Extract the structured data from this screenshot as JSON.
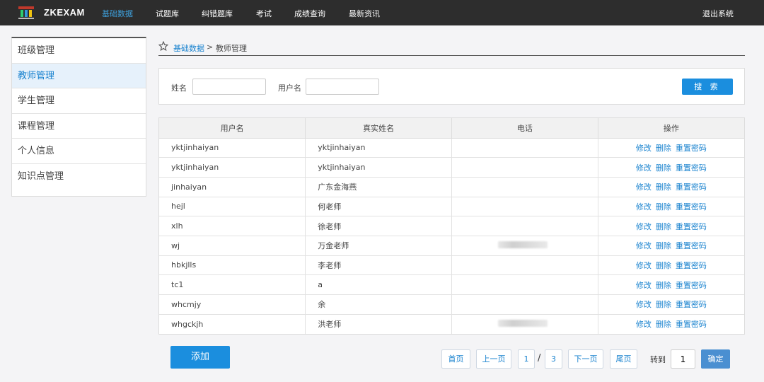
{
  "topbar": {
    "brand": "ZKEXAM",
    "nav": [
      {
        "label": "基础数据",
        "active": true
      },
      {
        "label": "试题库",
        "active": false
      },
      {
        "label": "纠错题库",
        "active": false
      },
      {
        "label": "考试",
        "active": false
      },
      {
        "label": "成绩查询",
        "active": false
      },
      {
        "label": "最新资讯",
        "active": false
      }
    ],
    "logout": "退出系统"
  },
  "sidebar": {
    "items": [
      {
        "label": "班级管理"
      },
      {
        "label": "教师管理",
        "active": true
      },
      {
        "label": "学生管理"
      },
      {
        "label": "课程管理"
      },
      {
        "label": "个人信息"
      },
      {
        "label": "知识点管理"
      }
    ]
  },
  "breadcrumb": {
    "parent": "基础数据",
    "separator": ">",
    "current": "教师管理"
  },
  "search": {
    "name_label": "姓名",
    "name_value": "",
    "username_label": "用户名",
    "username_value": "",
    "button": "搜 索"
  },
  "table": {
    "headers": [
      "用户名",
      "真实姓名",
      "电话",
      "操作"
    ],
    "rows": [
      {
        "username": "yktjinhaiyan",
        "realname": "yktjinhaiyan",
        "phone_redacted": false
      },
      {
        "username": "yktjinhaiyan",
        "realname": "yktjinhaiyan",
        "phone_redacted": false
      },
      {
        "username": "jinhaiyan",
        "realname": "广东金海燕",
        "phone_redacted": false
      },
      {
        "username": "hejl",
        "realname": "何老师",
        "phone_redacted": false
      },
      {
        "username": "xlh",
        "realname": "徐老师",
        "phone_redacted": false
      },
      {
        "username": "wj",
        "realname": "万金老师",
        "phone_redacted": true
      },
      {
        "username": "hbkjlls",
        "realname": "李老师",
        "phone_redacted": false
      },
      {
        "username": "tc1",
        "realname": "a",
        "phone_redacted": false
      },
      {
        "username": "whcmjy",
        "realname": "余",
        "phone_redacted": false
      },
      {
        "username": "whgckjh",
        "realname": "洪老师",
        "phone_redacted": true
      }
    ],
    "actions": {
      "edit": "修改",
      "delete": "删除",
      "reset": "重置密码"
    }
  },
  "add_button": "添加",
  "pagination": {
    "first": "首页",
    "prev": "上一页",
    "current": "1",
    "slash": "/",
    "total": "3",
    "next": "下一页",
    "last": "尾页",
    "goto_label": "转到",
    "goto_value": "1",
    "confirm": "确定"
  },
  "colors": {
    "accent": "#1b8ede",
    "topbar": "#2d2d2d",
    "link": "#1a83cf"
  }
}
